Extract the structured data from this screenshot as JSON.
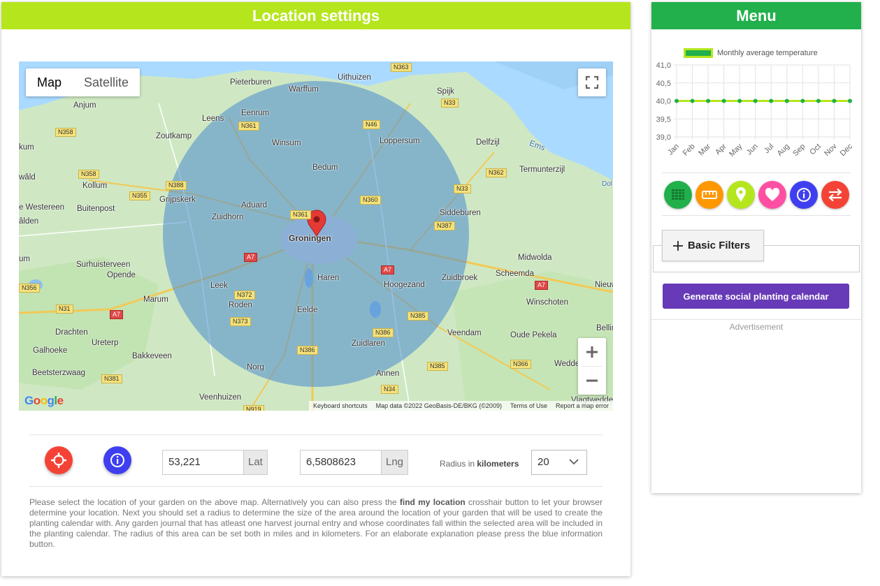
{
  "location_panel": {
    "title": "Location settings",
    "map": {
      "type_buttons": [
        "Map",
        "Satellite"
      ],
      "active_type": "Map",
      "footer": {
        "shortcuts": "Keyboard shortcuts",
        "map_data": "Map data ©2022 GeoBasis-DE/BKG (©2009)",
        "terms": "Terms of Use",
        "report": "Report a map error"
      },
      "logo": "Google",
      "marker_city": "Groningen",
      "places": {
        "uithuizen": "Uithuizen",
        "pieterburen": "Pieterburen",
        "warffum": "Warffum",
        "spijk": "Spijk",
        "anjum": "Anjum",
        "eenrum": "Eenrum",
        "leens": "Leens",
        "zoutkamp": "Zoutkamp",
        "winsum": "Winsum",
        "loppersum": "Loppersum",
        "delfzijl": "Delfzijl",
        "kum": "kum",
        "bedum": "Bedum",
        "termunterzijl": "Termunterzijl",
        "wald": "wâld",
        "kollum": "Kollum",
        "grijpskerk": "Grijpskerk",
        "aduard": "Aduard",
        "westereen": "e Westereen",
        "buitenpost": "Buitenpost",
        "zuidhorn": "Zuidhorn",
        "siddeburen": "Siddeburen",
        "alden": "âlden",
        "groningen": "Groningen",
        "um": "um",
        "surhuisterveen": "Surhuisterveen",
        "midwolda": "Midwolda",
        "opende": "Opende",
        "scheemda": "Scheemda",
        "haren": "Haren",
        "zuidbroek": "Zuidbroek",
        "leek": "Leek",
        "hoogezand": "Hoogezand",
        "nieuw": "Nieuw",
        "marum": "Marum",
        "roden": "Roden",
        "winschoten": "Winschoten",
        "eelde": "Eelde",
        "drachten": "Drachten",
        "bellin": "Bellin",
        "veendam": "Veendam",
        "oude_pekela": "Oude Pekela",
        "ureterp": "Ureterp",
        "galhoeke": "Galhoeke",
        "zuidlaren": "Zuidlaren",
        "bakkeveen": "Bakkeveen",
        "norg": "Norg",
        "wedde": "Wedde",
        "beetsterzwaag": "Beetsterzwaag",
        "annen": "Annen",
        "veenhuizen": "Veenhuizen",
        "vlagtwedde": "Vlagtwedde",
        "ems": "Ems",
        "dol": "Dol"
      },
      "roads": {
        "n363": "N363",
        "n33a": "N33",
        "n358a": "N358",
        "n361a": "N361",
        "n46": "N46",
        "n358b": "N358",
        "n388": "N388",
        "n362": "N362",
        "n33b": "N33",
        "n355": "N355",
        "n360": "N360",
        "n361b": "N361",
        "n387": "N387",
        "a7a": "A7",
        "a7b": "A7",
        "n356": "N356",
        "n372": "N372",
        "a7c": "A7",
        "n31": "N31",
        "a7d": "A7",
        "n373": "N373",
        "n385a": "N385",
        "n386a": "N386",
        "n386b": "N386",
        "n381": "N381",
        "n366": "N366",
        "n385b": "N385",
        "n34": "N34",
        "n919": "N919"
      }
    },
    "controls": {
      "lat_value": "53,221",
      "lat_addon": "Lat",
      "lng_value": "6,5808623",
      "lng_addon": "Lng",
      "radius_prefix": "Radius in",
      "radius_unit": "kilometers",
      "radius_value": "20"
    },
    "help": {
      "part1": "Please select the location of your garden on the above map. Alternatively you can also press the",
      "bold": "find my location",
      "part2": "crosshair button to let your browser determine your location. Next you should set a radius to determine the size of the area around the location of your garden that will be used to create the planting calendar with. Any garden journal that has atleast one harvest journal entry and whose coordinates fall within the selected area will be included in the planting calendar. The radius of this area can be set both in miles and in kilometers. For an elaborate explanation please press the blue information button."
    }
  },
  "menu_panel": {
    "title": "Menu",
    "filter_label": "Basic Filters",
    "generate_label": "Generate social planting calendar",
    "ad_label": "Advertisement",
    "icons": [
      {
        "name": "grid-icon",
        "color": "#21b04b"
      },
      {
        "name": "ruler-icon",
        "color": "#ff9800"
      },
      {
        "name": "location-pin-icon",
        "color": "#b5e61d"
      },
      {
        "name": "heart-icon",
        "color": "#ff4fa3"
      },
      {
        "name": "info-icon",
        "color": "#3f3ff0"
      },
      {
        "name": "swap-icon",
        "color": "#f44336"
      }
    ]
  },
  "chart_data": {
    "type": "line",
    "categories": [
      "Jan",
      "Feb",
      "Mar",
      "Apr",
      "May",
      "Jun",
      "Jul",
      "Aug",
      "Sep",
      "Oct",
      "Nov",
      "Dec"
    ],
    "series": [
      {
        "name": "Monthly average temperature",
        "values": [
          40,
          40,
          40,
          40,
          40,
          40,
          40,
          40,
          40,
          40,
          40,
          40
        ],
        "color": "#b5e61d"
      }
    ],
    "ylim": [
      39,
      41
    ],
    "yticks": [
      "41,0",
      "40,5",
      "40,0",
      "39,5",
      "39,0"
    ],
    "grid": true,
    "legend": "top"
  }
}
